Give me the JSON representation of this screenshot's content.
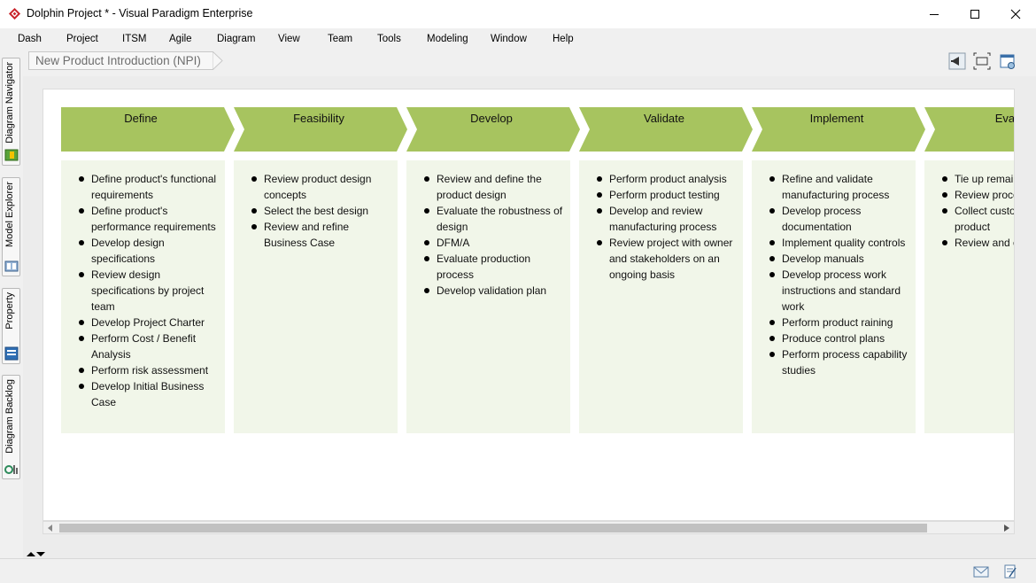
{
  "window": {
    "title": "Dolphin Project * - Visual Paradigm Enterprise",
    "app_icon": "visual-paradigm-logo-icon",
    "controls": [
      "minimize-icon",
      "maximize-icon",
      "close-icon"
    ]
  },
  "menu": {
    "items": [
      {
        "label": "Dash"
      },
      {
        "label": "Project"
      },
      {
        "label": "ITSM"
      },
      {
        "label": "Agile"
      },
      {
        "label": "Diagram"
      },
      {
        "label": "View"
      },
      {
        "label": "Team"
      },
      {
        "label": "Tools"
      },
      {
        "label": "Modeling"
      },
      {
        "label": "Window"
      },
      {
        "label": "Help"
      }
    ]
  },
  "dock": {
    "tabs": [
      {
        "label": "Diagram Navigator",
        "icon": "diagram-navigator-icon"
      },
      {
        "label": "Model Explorer",
        "icon": "model-explorer-icon"
      },
      {
        "label": "Property",
        "icon": "property-icon"
      },
      {
        "label": "Diagram Backlog",
        "icon": "diagram-backlog-icon"
      }
    ]
  },
  "breadcrumb": {
    "label": "New Product Introduction (NPI)"
  },
  "toolbar": {
    "icons": [
      "announce-icon",
      "fit-diagram-icon",
      "layout-settings-icon"
    ]
  },
  "colors": {
    "phase_header": "#a7c45f",
    "phase_body": "#f1f6e9",
    "canvas_background": "#ffffff"
  },
  "phases": [
    {
      "title": "Define",
      "items": [
        "Define product's functional requirements",
        "Define product's performance requirements",
        "Develop design specifications",
        "Review design specifications by project team",
        "Develop Project Charter",
        "Perform Cost / Benefit Analysis",
        "Perform risk assessment",
        "Develop Initial Business Case"
      ]
    },
    {
      "title": "Feasibility",
      "items": [
        "Review product design concepts",
        "Select the best design",
        "Review and refine Business Case"
      ]
    },
    {
      "title": "Develop",
      "items": [
        "Review and define the product design",
        "Evaluate the robustness of design",
        "DFM/A",
        "Evaluate production process",
        "Develop validation plan"
      ]
    },
    {
      "title": "Validate",
      "items": [
        "Perform product analysis",
        "Perform product testing",
        "Develop and review manufacturing process",
        "Review project with owner and stakeholders on an ongoing basis"
      ]
    },
    {
      "title": "Implement",
      "items": [
        "Refine and validate manufacturing process",
        "Develop process documentation",
        "Implement quality controls",
        "Develop manuals",
        "Develop process work instructions and standard work",
        "Perform product raining",
        "Produce control plans",
        "Perform process capability studies"
      ]
    },
    {
      "title": "Evalu",
      "items": [
        "Tie up remai documentati",
        "Review proce performance",
        "Collect custo feedback on product",
        "Review and c any lessons l"
      ]
    }
  ],
  "statusbar": {
    "icons": [
      "mail-icon",
      "document-edit-icon"
    ]
  }
}
